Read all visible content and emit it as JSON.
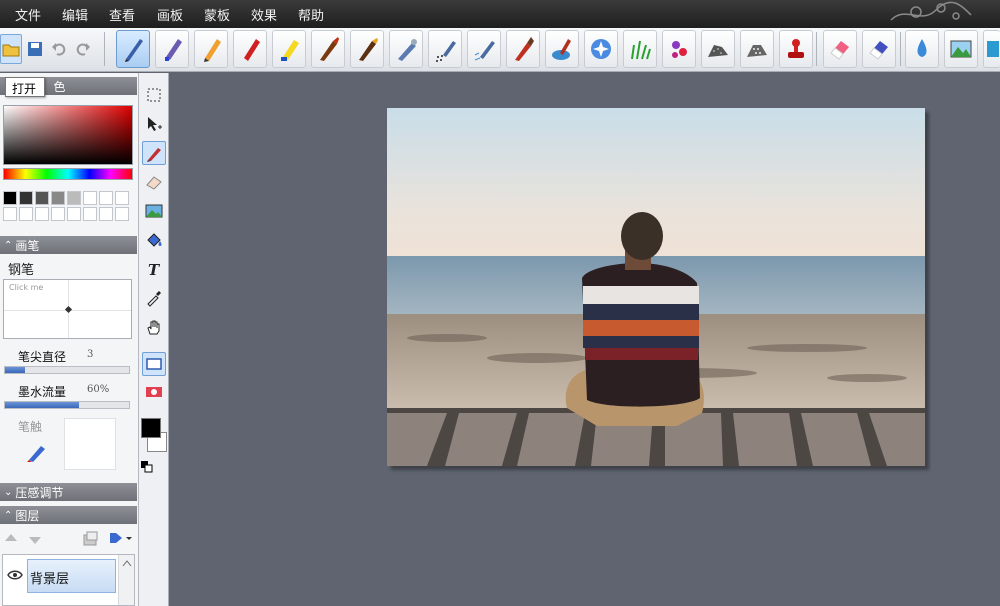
{
  "menu": [
    "文件",
    "编辑",
    "查看",
    "画板",
    "蒙板",
    "效果",
    "帮助"
  ],
  "toolbar": {
    "file_buttons": [
      "open-icon",
      "save-icon",
      "undo-icon",
      "redo-icon"
    ],
    "brushes": [
      "pen-icon",
      "marker-icon",
      "pencil-icon",
      "crayon-icon",
      "highlighter-icon",
      "oil-brush-icon",
      "flat-brush-icon",
      "airbrush-icon",
      "spray-icon",
      "splatter-icon",
      "fan-brush-icon",
      "watercolor-icon",
      "blur-icon",
      "grass-icon",
      "flower-icon",
      "texture-icon",
      "pattern-icon",
      "stamp-icon",
      "eraser-icon",
      "soft-eraser-icon",
      "water-drop-icon",
      "landscape-icon"
    ]
  },
  "tooltip": "打开",
  "panels": {
    "color": {
      "title": "色"
    },
    "brush": {
      "title": "画笔",
      "name": "钢笔",
      "preview_hint": "Click me"
    },
    "params": [
      {
        "label": "笔尖直径",
        "value": "3",
        "fill_percent": 16
      },
      {
        "label": "墨水流量",
        "value": "60%",
        "fill_percent": 60
      }
    ],
    "blend": {
      "label": "笔触"
    },
    "pressure": {
      "title": "压感调节"
    },
    "layers": {
      "title": "图层",
      "items": [
        {
          "name": "背景层"
        }
      ]
    }
  },
  "colors": {
    "foreground": "#000000",
    "background": "#ffffff",
    "swatches_row1": [
      "#000000",
      "#333333",
      "#555555",
      "#888888",
      "#bbbbbb",
      "#ffffff",
      "#ffffff",
      "#ffffff"
    ]
  },
  "tools": [
    "marquee-icon",
    "move-icon",
    "brush-icon",
    "eraser-icon",
    "image-icon",
    "fill-icon",
    "text-icon",
    "eyedropper-icon",
    "hand-icon",
    "rectangle-icon",
    "ellipse-icon"
  ]
}
